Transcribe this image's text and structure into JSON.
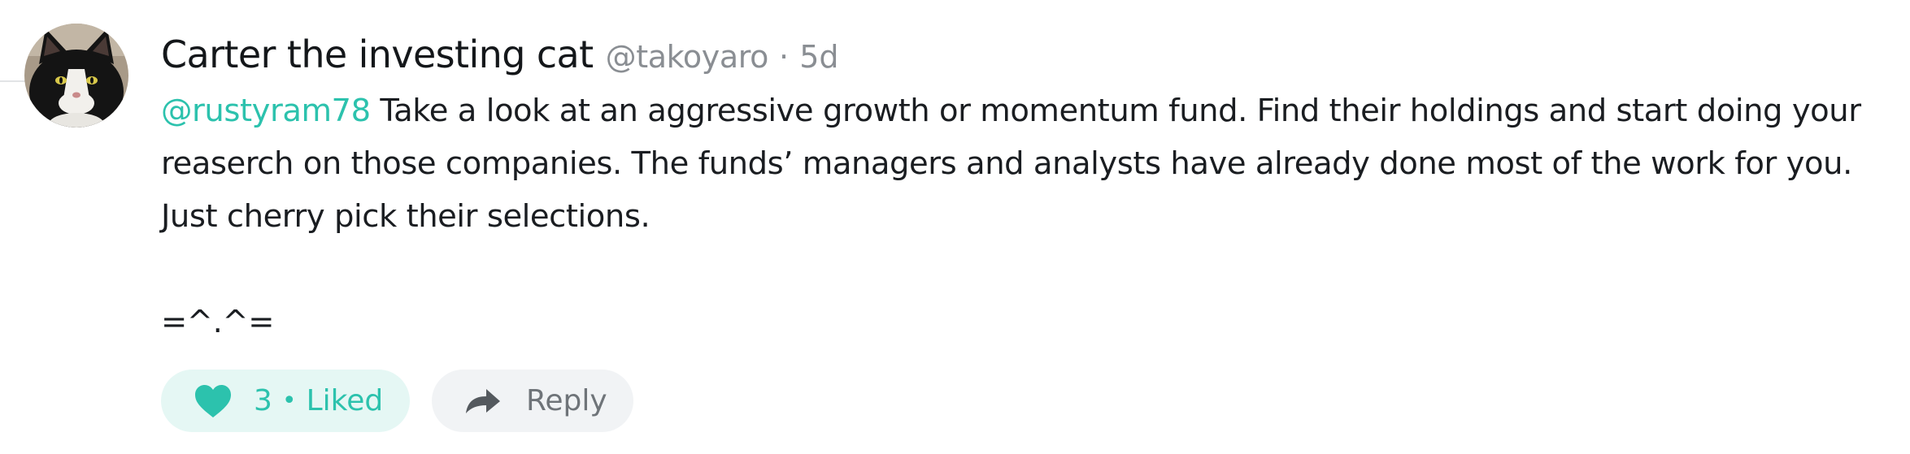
{
  "post": {
    "author_name": "Carter the investing cat",
    "handle": "@takoyaro",
    "separator": "·",
    "time_ago": "5d",
    "mention": "@rustyram78",
    "body_text": " Take a look at an aggressive growth or momentum fund. Find their holdings and start doing your reaserch on those companies. The funds’ managers and analysts have already done most of the work for you. Just cherry pick their selections.",
    "signature": "=^.^="
  },
  "actions": {
    "like_count": "3",
    "like_separator": "•",
    "like_label": "Liked",
    "reply_label": "Reply"
  },
  "colors": {
    "accent": "#2cc2ad",
    "like_bg": "#e5f7f4",
    "reply_bg": "#f1f3f5",
    "muted_text": "#8a8e93"
  },
  "icons": {
    "like": "heart-icon",
    "reply": "reply-arrow-icon"
  }
}
